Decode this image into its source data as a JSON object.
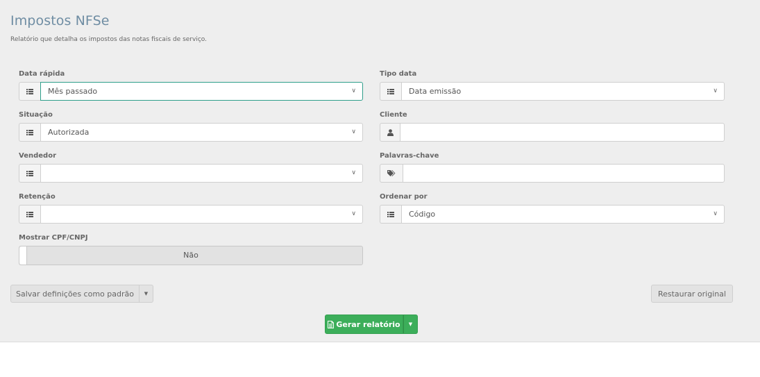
{
  "header": {
    "title": "Impostos NFSe",
    "subtitle": "Relatório que detalha os impostos das notas fiscais de serviço."
  },
  "fields": {
    "data_rapida": {
      "label": "Data rápida",
      "value": "Mês passado",
      "icon": "list-icon"
    },
    "tipo_data": {
      "label": "Tipo data",
      "value": "Data emissão",
      "icon": "list-icon"
    },
    "situacao": {
      "label": "Situação",
      "value": "Autorizada",
      "icon": "list-icon"
    },
    "cliente": {
      "label": "Cliente",
      "value": "",
      "icon": "user-icon"
    },
    "vendedor": {
      "label": "Vendedor",
      "value": "",
      "icon": "list-icon"
    },
    "palavras_chave": {
      "label": "Palavras-chave",
      "value": "",
      "icon": "tags-icon"
    },
    "retencao": {
      "label": "Retenção",
      "value": "",
      "icon": "list-icon"
    },
    "ordenar_por": {
      "label": "Ordenar por",
      "value": "Código",
      "icon": "list-icon"
    },
    "mostrar_cpf": {
      "label": "Mostrar CPF/CNPJ",
      "value": "Não"
    }
  },
  "actions": {
    "save_defaults": "Salvar definições como padrão",
    "restore": "Restaurar original",
    "generate": "Gerar relatório"
  },
  "colors": {
    "title": "#6f8da3",
    "focus_border": "#2e9e8a",
    "primary_button": "#3cae5a"
  }
}
